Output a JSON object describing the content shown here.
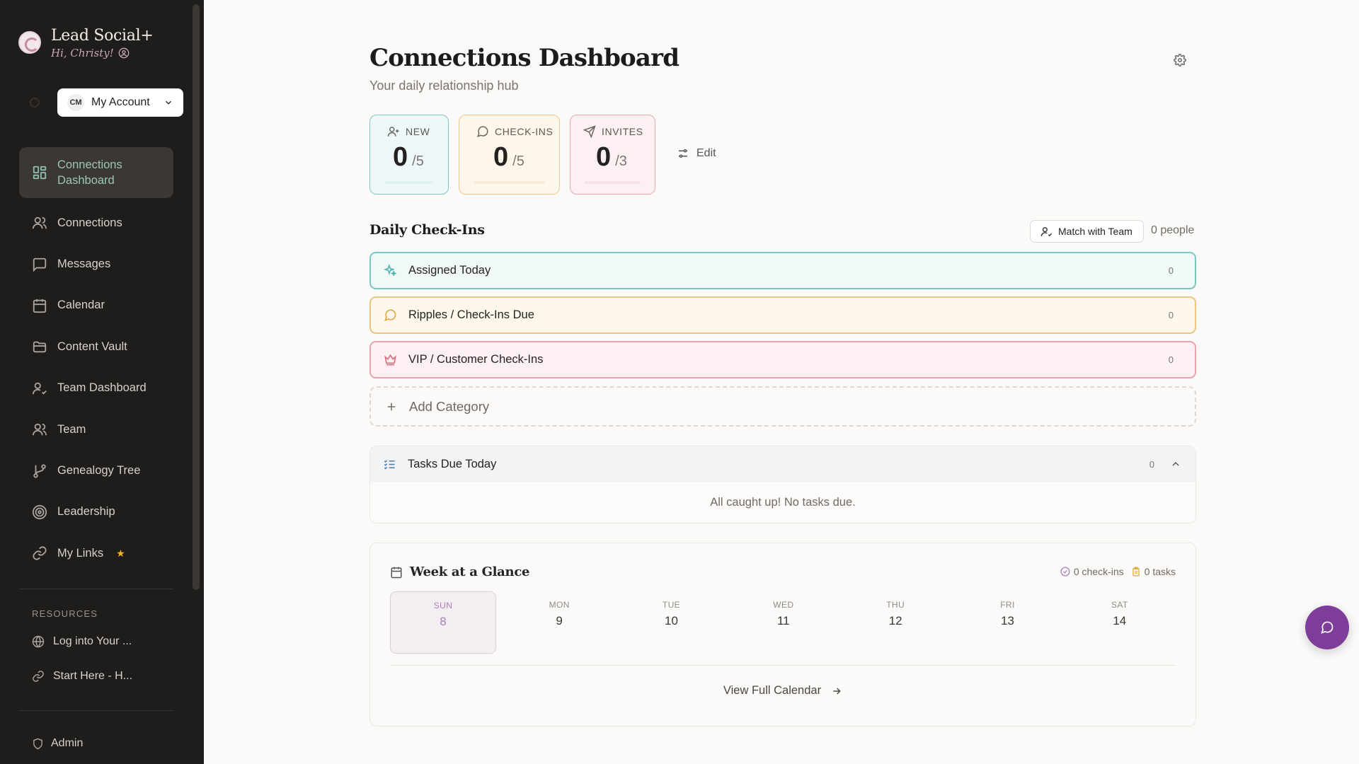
{
  "brand": {
    "name": "Lead Social+",
    "greeting": "Hi, Christy!"
  },
  "account": {
    "initials": "CM",
    "label": "My Account"
  },
  "nav": {
    "items": [
      {
        "label": "Connections Dashboard",
        "icon": "dashboard-icon"
      },
      {
        "label": "Connections",
        "icon": "users-icon"
      },
      {
        "label": "Messages",
        "icon": "message-square-icon"
      },
      {
        "label": "Calendar",
        "icon": "calendar-icon"
      },
      {
        "label": "Content Vault",
        "icon": "folder-icon"
      },
      {
        "label": "Team Dashboard",
        "icon": "user-check-icon"
      },
      {
        "label": "Team",
        "icon": "team-icon"
      },
      {
        "label": "Genealogy Tree",
        "icon": "git-branch-icon"
      },
      {
        "label": "Leadership",
        "icon": "target-icon"
      },
      {
        "label": "My Links",
        "icon": "link-icon"
      }
    ]
  },
  "resources": {
    "title": "RESOURCES",
    "items": [
      {
        "label": "Log into Your ...",
        "icon": "globe-icon"
      },
      {
        "label": "Start Here - H...",
        "icon": "link-icon"
      }
    ]
  },
  "admin": {
    "label": "Admin"
  },
  "header": {
    "title": "Connections Dashboard",
    "subtitle": "Your daily relationship hub"
  },
  "stats": [
    {
      "label": "NEW",
      "value": "0",
      "goal": "/5",
      "accent": "#7cc8c3",
      "bg": "#eef8f8"
    },
    {
      "label": "CHECK-INS",
      "value": "0",
      "goal": "/5",
      "accent": "#ecc98c",
      "bg": "#fdf6ea"
    },
    {
      "label": "INVITES",
      "value": "0",
      "goal": "/3",
      "accent": "#e9a6b4",
      "bg": "#fcf0f2"
    }
  ],
  "edit_label": "Edit",
  "checkins": {
    "title": "Daily Check-Ins",
    "match_label": "Match with Team",
    "people_count": "0 people",
    "categories": [
      {
        "label": "Assigned Today",
        "count": "0",
        "color": "#79c7c0",
        "bg": "#f0f8f8",
        "icon": "sparkles-icon"
      },
      {
        "label": "Ripples / Check-Ins Due",
        "count": "0",
        "color": "#eac67f",
        "bg": "#fdf7ec",
        "icon": "message-circle-icon"
      },
      {
        "label": "VIP / Customer Check-Ins",
        "count": "0",
        "color": "#e8a3b0",
        "bg": "#fcf0f2",
        "icon": "crown-icon"
      }
    ],
    "add_label": "Add Category"
  },
  "tasks": {
    "title": "Tasks Due Today",
    "count": "0",
    "empty": "All caught up! No tasks due."
  },
  "week": {
    "title": "Week at a Glance",
    "checkins_summary": "0 check-ins",
    "tasks_summary": "0 tasks",
    "days": [
      {
        "name": "SUN",
        "date": "8",
        "today": true
      },
      {
        "name": "MON",
        "date": "9"
      },
      {
        "name": "TUE",
        "date": "10"
      },
      {
        "name": "WED",
        "date": "11"
      },
      {
        "name": "THU",
        "date": "12"
      },
      {
        "name": "FRI",
        "date": "13"
      },
      {
        "name": "SAT",
        "date": "14"
      }
    ],
    "view_full": "View Full Calendar"
  }
}
